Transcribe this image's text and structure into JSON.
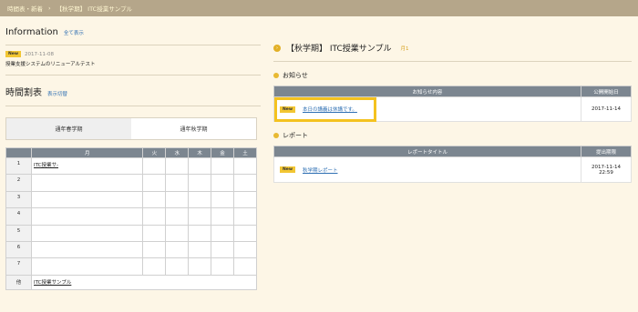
{
  "topbar": {
    "item1": "時間表・新着",
    "item2": "【秋学期】 ITC授業サンプル"
  },
  "information": {
    "title": "Information",
    "link": "全て表示",
    "badge": "New",
    "date": "2017-11-08",
    "text": "授業支援システムのリニューアルテスト"
  },
  "timetable": {
    "title": "時間割表",
    "link": "表示切替",
    "tabs": [
      "通年春学期",
      "通年秋学期"
    ],
    "days": [
      "月",
      "火",
      "水",
      "木",
      "金",
      "土"
    ],
    "rows": [
      "1",
      "2",
      "3",
      "4",
      "5",
      "6",
      "7"
    ],
    "row1_course": "ITC授業サ-",
    "other_label": "他",
    "other_course": "ITC授業サンプル"
  },
  "course": {
    "icon": "chevron-right-icon",
    "title": "【秋学期】 ITC授業サンプル",
    "day": "月1"
  },
  "notices": {
    "heading": "お知らせ",
    "col_content": "お知らせ内容",
    "col_date": "公開開始日",
    "badge": "New",
    "item": "本日の講義は休講です。",
    "date": "2017-11-14"
  },
  "reports": {
    "heading": "レポート",
    "col_title": "レポートタイトル",
    "col_deadline": "提出期限",
    "badge": "New",
    "item": "秋学期レポート",
    "date": "2017-11-14",
    "time": "22:59"
  },
  "colors": {
    "topbar": "#b5a68a",
    "accent": "#f4c21f",
    "link": "#2e6fb3",
    "table_header": "#7c8690"
  }
}
